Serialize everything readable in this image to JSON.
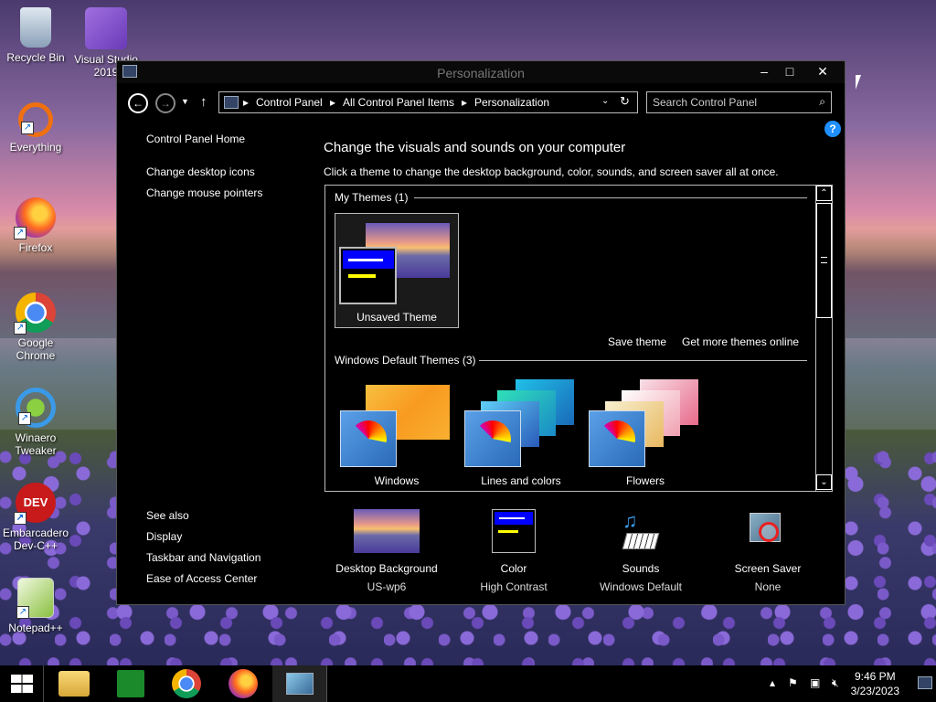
{
  "desktop": {
    "icons": [
      {
        "label": "Recycle Bin",
        "icon": "recycle-bin-icon"
      },
      {
        "label": "Visual Studio 2019",
        "icon": "visual-studio-icon"
      },
      {
        "label": "Everything",
        "icon": "everything-search-icon"
      },
      {
        "label": "Firefox",
        "icon": "firefox-icon"
      },
      {
        "label": "Google Chrome",
        "icon": "chrome-icon"
      },
      {
        "label": "Winaero Tweaker",
        "icon": "winaero-tweaker-icon"
      },
      {
        "label": "Embarcadero Dev-C++",
        "icon": "devcpp-icon"
      },
      {
        "label": "Notepad++",
        "icon": "notepadpp-icon"
      }
    ]
  },
  "window": {
    "title": "Personalization",
    "controls": {
      "minimize": "–",
      "maximize": "□",
      "close": "✕"
    }
  },
  "navbar": {
    "breadcrumbs": [
      "Control Panel",
      "All Control Panel Items",
      "Personalization"
    ],
    "search_placeholder": "Search Control Panel",
    "help": "?"
  },
  "leftnav": {
    "home": "Control Panel Home",
    "links": [
      "Change desktop icons",
      "Change mouse pointers"
    ]
  },
  "main": {
    "heading": "Change the visuals and sounds on your computer",
    "subheading": "Click a theme to change the desktop background, color, sounds, and screen saver all at once.",
    "my_themes": {
      "title": "My Themes (1)",
      "items": [
        {
          "label": "Unsaved Theme"
        }
      ]
    },
    "links": {
      "save_theme": "Save theme",
      "get_more": "Get more themes online"
    },
    "default_themes": {
      "title": "Windows Default Themes (3)",
      "items": [
        {
          "label": "Windows"
        },
        {
          "label": "Lines and colors"
        },
        {
          "label": "Flowers"
        }
      ]
    }
  },
  "see_also": {
    "title": "See also",
    "links": [
      "Display",
      "Taskbar and Navigation",
      "Ease of Access Center"
    ]
  },
  "bottom": [
    {
      "label": "Desktop Background",
      "value": "US-wp6",
      "icon": "desktop-background-icon"
    },
    {
      "label": "Color",
      "value": "High Contrast",
      "icon": "color-icon"
    },
    {
      "label": "Sounds",
      "value": "Windows Default",
      "icon": "sounds-icon"
    },
    {
      "label": "Screen Saver",
      "value": "None",
      "icon": "screen-saver-icon"
    }
  ],
  "taskbar": {
    "time": "9:46 PM",
    "date": "3/23/2023"
  },
  "colors": {
    "accent_blue": "#0000ff",
    "highlight_yellow": "#ffff00",
    "help_blue": "#1e90ff"
  }
}
